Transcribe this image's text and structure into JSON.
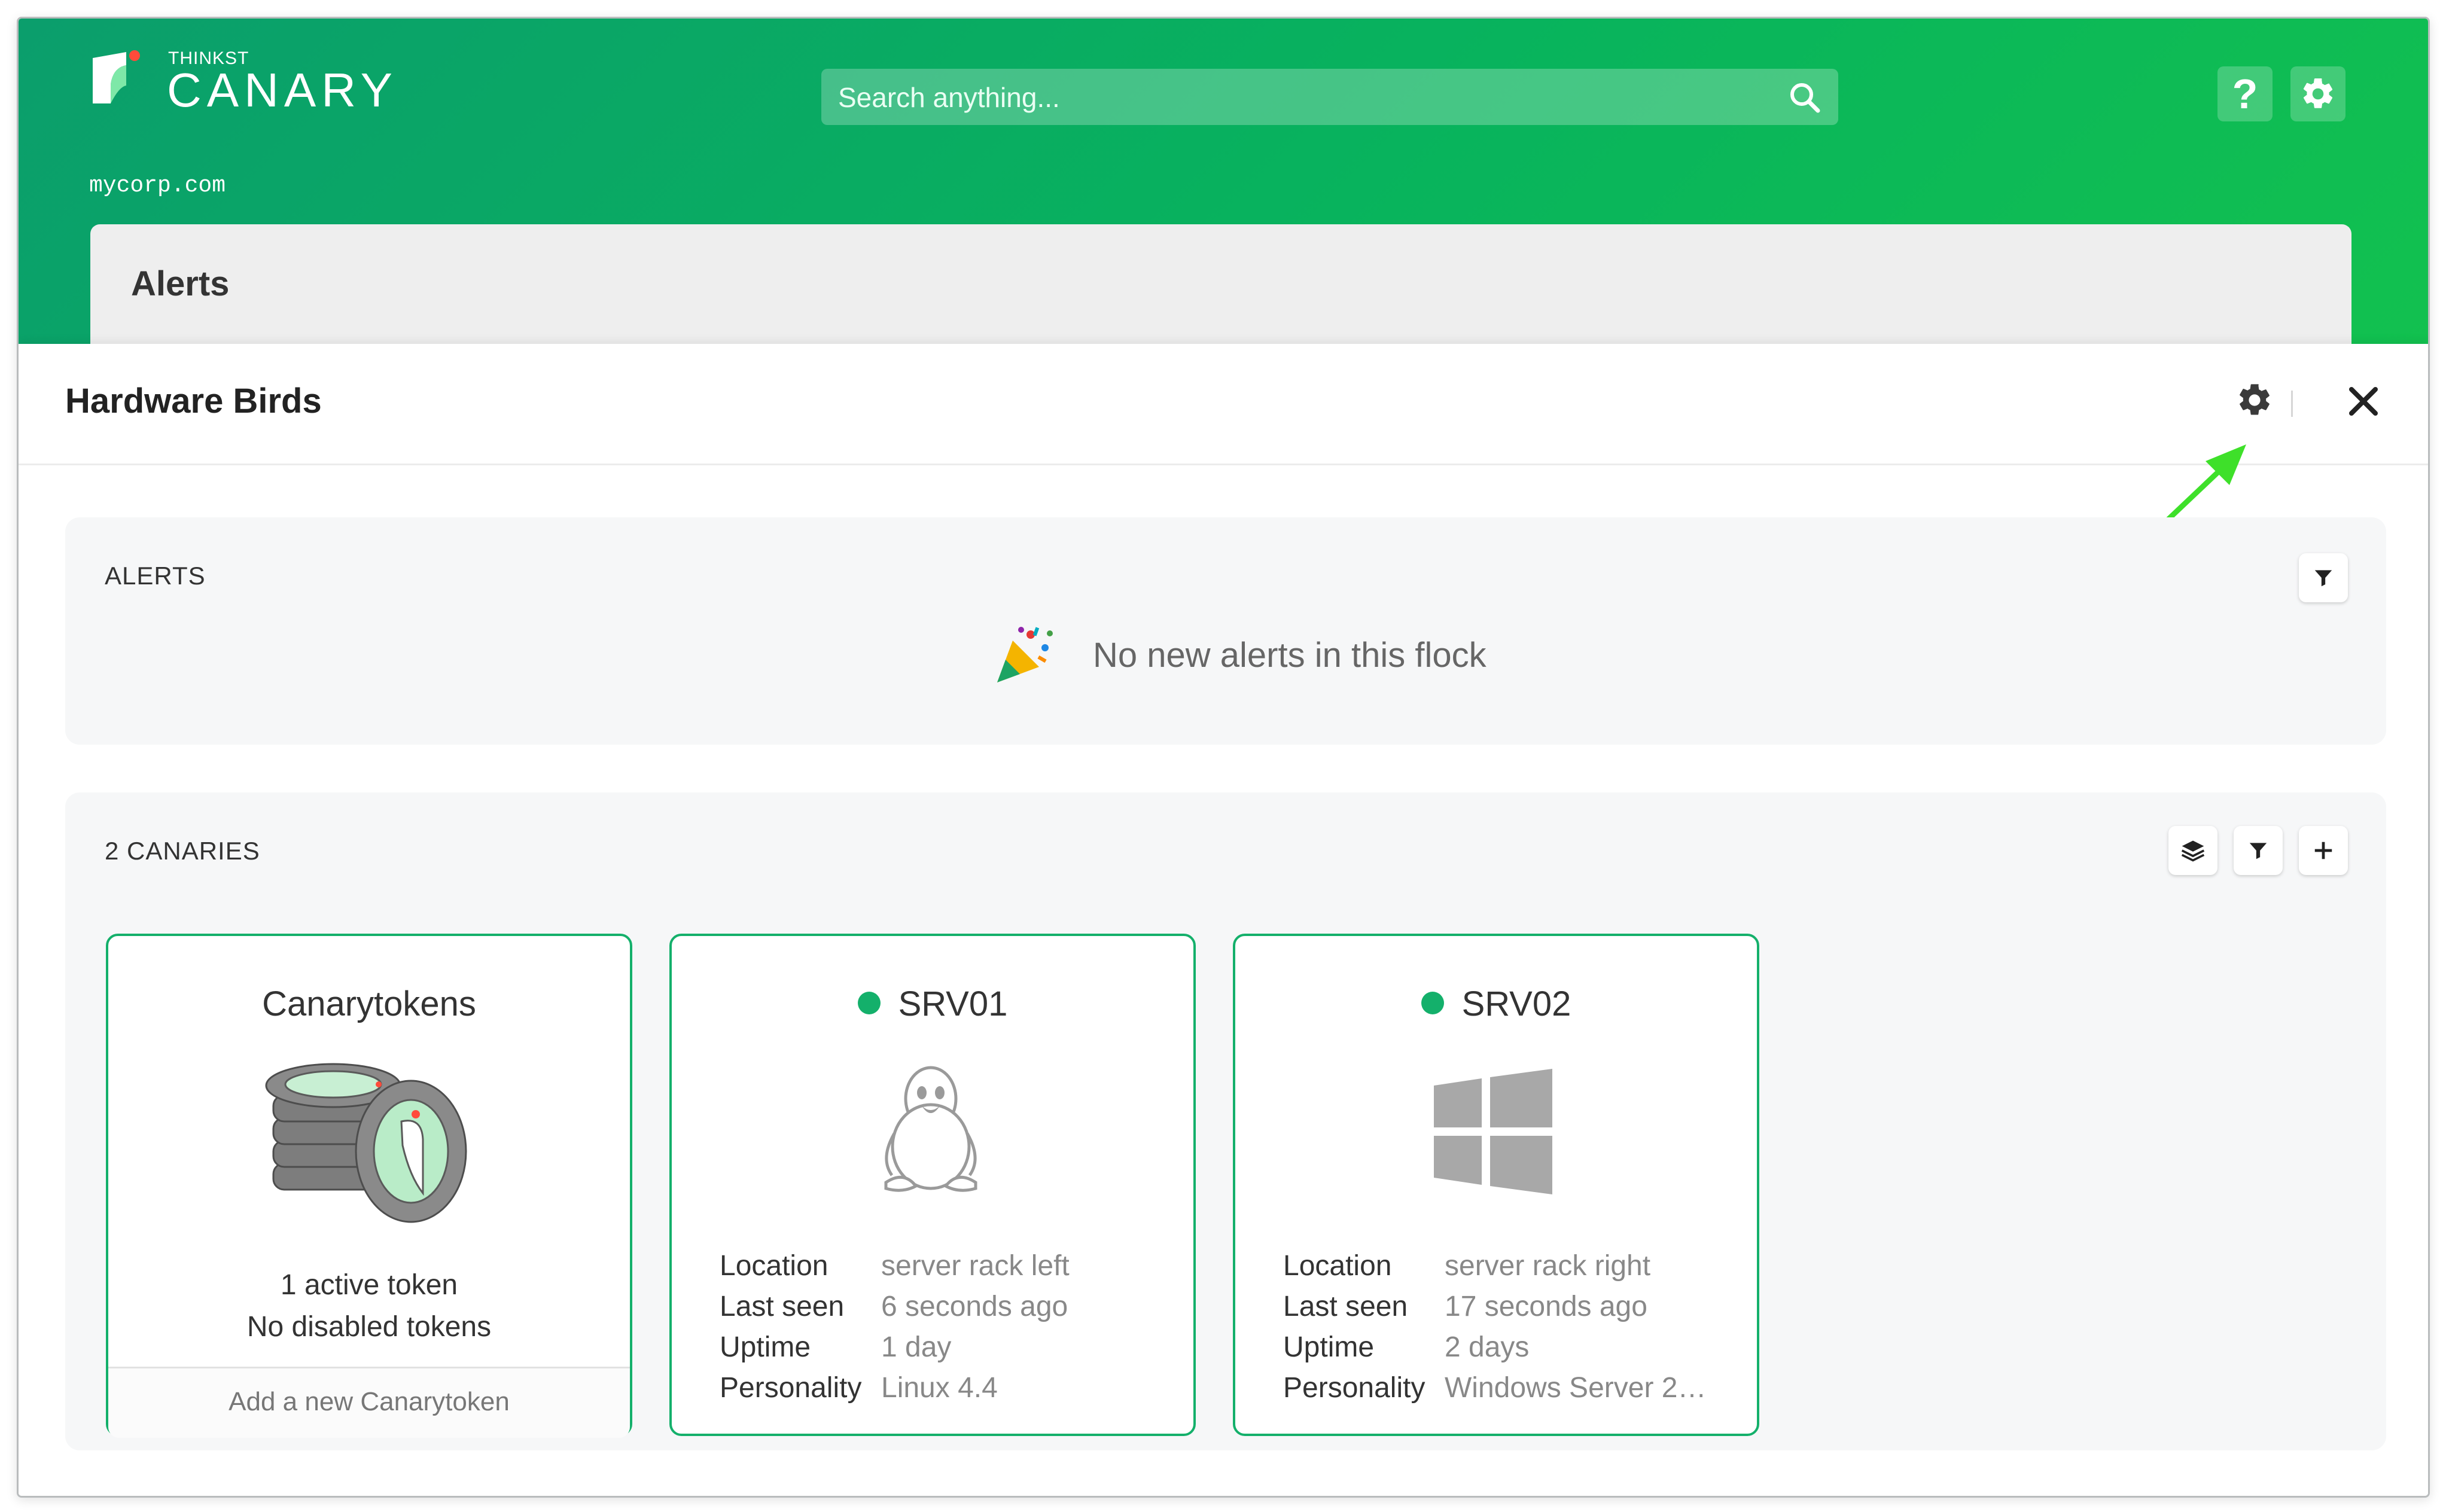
{
  "brand": {
    "small": "THINKST",
    "big": "CANARY",
    "domain": "mycorp.com"
  },
  "search": {
    "placeholder": "Search anything..."
  },
  "header": {
    "help_label": "?"
  },
  "alerts_card": {
    "title": "Alerts"
  },
  "panel": {
    "title": "Hardware Birds"
  },
  "alerts_section": {
    "label": "ALERTS",
    "empty_message": "No new alerts in this flock"
  },
  "canaries_section": {
    "label": "2 CANARIES"
  },
  "tokens_card": {
    "title": "Canarytokens",
    "active": "1 active token",
    "disabled": "No disabled tokens",
    "add_label": "Add a new Canarytoken"
  },
  "devices": [
    {
      "name": "SRV01",
      "status_color": "#14b06b",
      "os_icon": "linux-penguin-icon",
      "location_label": "Location",
      "location": "server rack left",
      "lastseen_label": "Last seen",
      "lastseen": "6 seconds ago",
      "uptime_label": "Uptime",
      "uptime": "1 day",
      "personality_label": "Personality",
      "personality": "Linux 4.4"
    },
    {
      "name": "SRV02",
      "status_color": "#14b06b",
      "os_icon": "windows-logo-icon",
      "location_label": "Location",
      "location": "server rack right",
      "lastseen_label": "Last seen",
      "lastseen": "17 seconds ago",
      "uptime_label": "Uptime",
      "uptime": "2 days",
      "personality_label": "Personality",
      "personality": "Windows Server 2…"
    }
  ],
  "colors": {
    "accent": "#14b06b",
    "header_start": "#0b9e6c",
    "header_end": "#12c14f",
    "annotation_arrow": "#3ee02a"
  }
}
